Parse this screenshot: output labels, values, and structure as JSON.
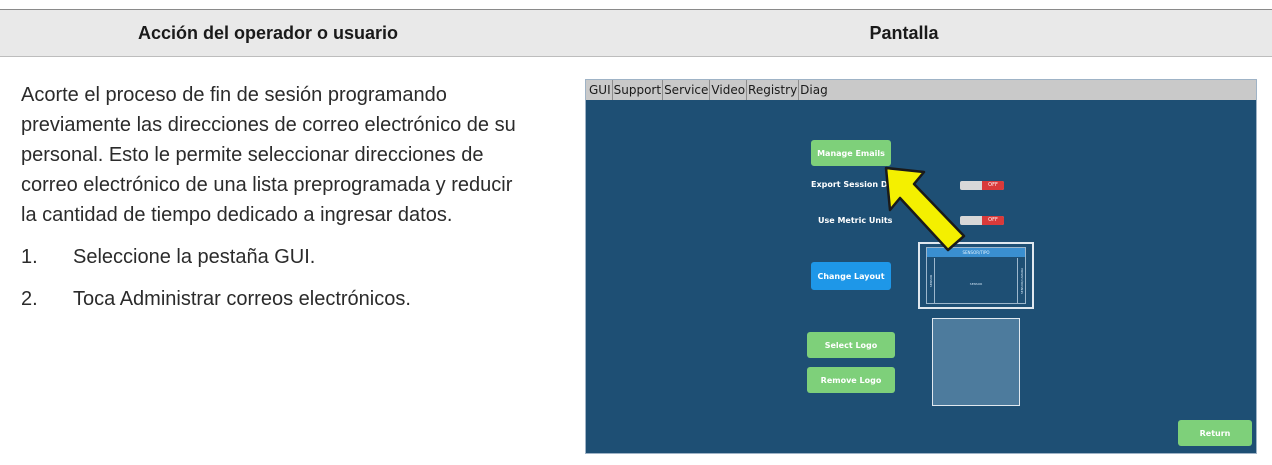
{
  "header": {
    "left": "Acción del operador o usuario",
    "right": "Pantalla"
  },
  "body": {
    "intro": "Acorte el proceso de fin de sesión programando previamente las direcciones de correo electrónico de su personal. Esto le permite seleccionar direcciones de correo electrónico de una lista preprogramada y reducir la cantidad de tiempo dedicado a ingresar datos.",
    "steps": [
      {
        "number": "1.",
        "text": "Seleccione la pestaña GUI."
      },
      {
        "number": "2.",
        "text": "Toca Administrar correos electrónicos."
      }
    ]
  },
  "screenshot": {
    "tabs": [
      "GUI",
      "Support",
      "Service",
      "Video",
      "Registry",
      "Diag"
    ],
    "manage_emails_label": "Manage Emails",
    "export_session_label": "Export Session Dat",
    "use_metric_label": "Use Metric Units",
    "toggle_off_label": "OFF",
    "change_layout_label": "Change Layout",
    "select_logo_label": "Select Logo",
    "remove_logo_label": "Remove Logo",
    "return_label": "Return",
    "layout_preview": {
      "header": "SENSOR/TIPO",
      "left": "SENSOR",
      "center": "SENSOR",
      "right": "SENSOR/CAMARA"
    },
    "colors": {
      "background": "#1e4f74",
      "green_button": "#7ed07a",
      "blue_button": "#1e97e8",
      "arrow_fill": "#f4f000",
      "toggle_off": "#d93a3a"
    },
    "arrow_icon": "callout-arrow-icon"
  }
}
